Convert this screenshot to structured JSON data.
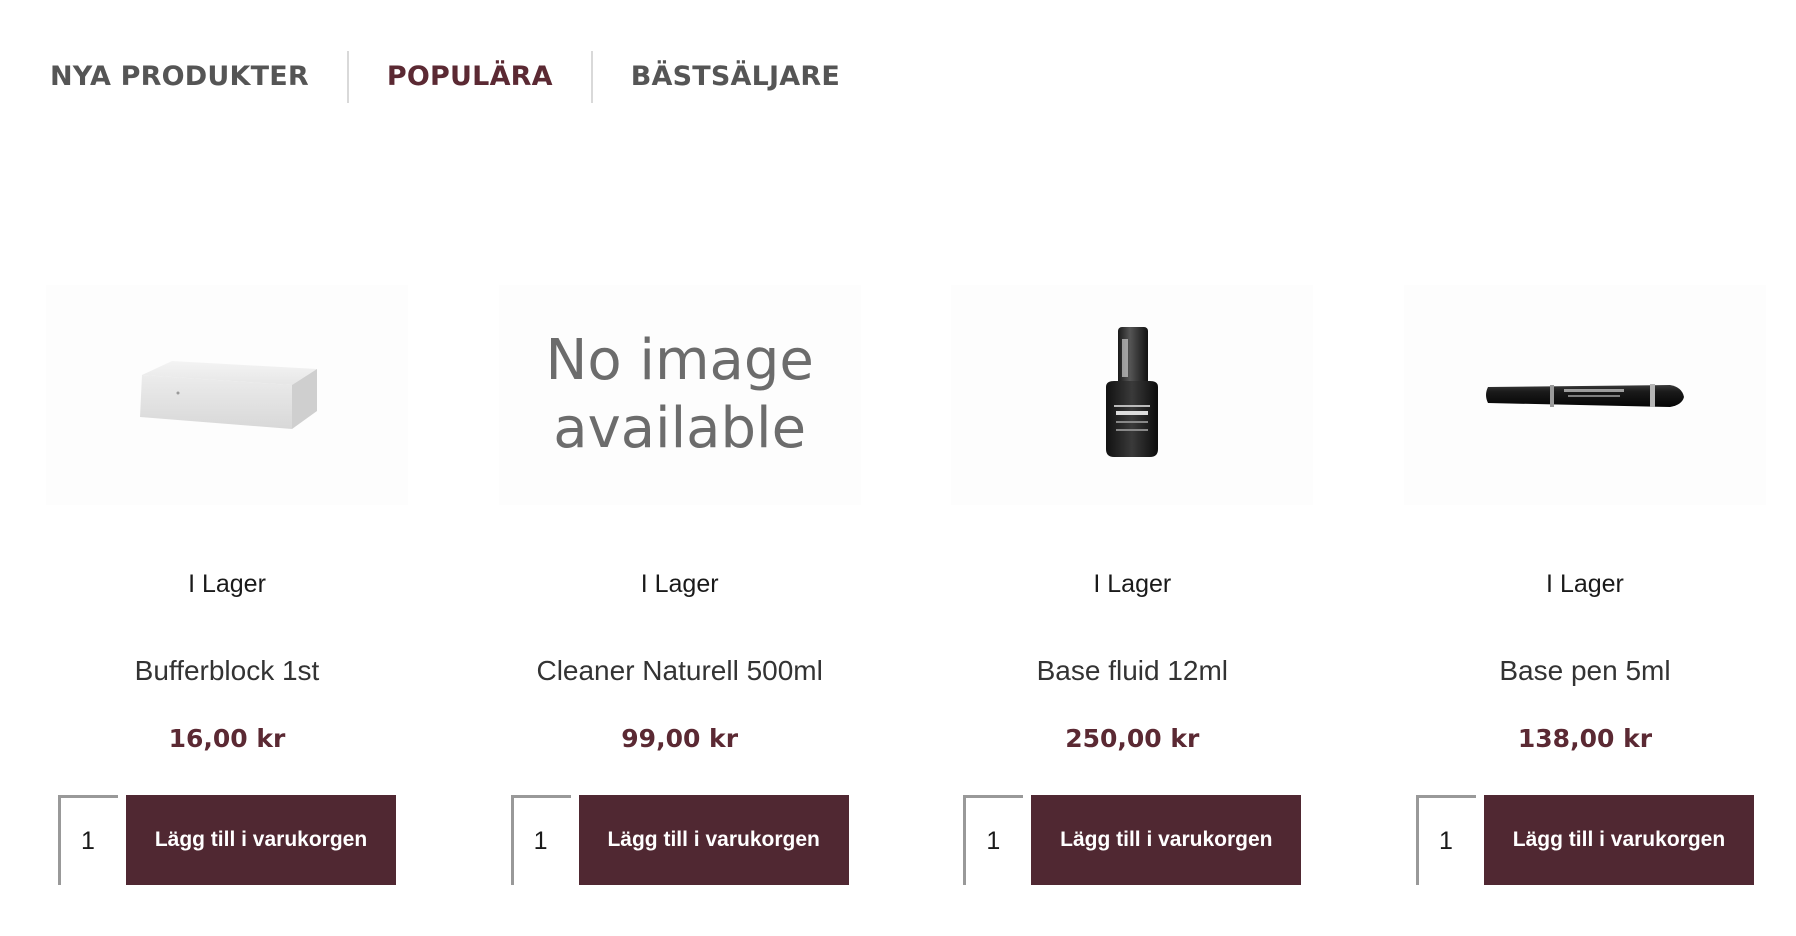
{
  "tabs": [
    {
      "label": "NYA PRODUKTER",
      "active": false
    },
    {
      "label": "POPULÄRA",
      "active": true
    },
    {
      "label": "BÄSTSÄLJARE",
      "active": false
    }
  ],
  "colors": {
    "brand": "#502832",
    "active_tab": "#5b2933",
    "price": "#5b2933"
  },
  "products": [
    {
      "image": "buffer-block-image",
      "stock": "I Lager",
      "name": "Bufferblock 1st",
      "price": "16,00 kr",
      "quantity": "1",
      "add_label": "Lägg till i varukorgen"
    },
    {
      "image": "no-image-placeholder",
      "no_image_line1": "No image",
      "no_image_line2": "available",
      "stock": "I Lager",
      "name": "Cleaner Naturell 500ml",
      "price": "99,00 kr",
      "quantity": "1",
      "add_label": "Lägg till i varukorgen"
    },
    {
      "image": "base-fluid-bottle-image",
      "stock": "I Lager",
      "name": "Base fluid 12ml",
      "price": "250,00 kr",
      "quantity": "1",
      "add_label": "Lägg till i varukorgen"
    },
    {
      "image": "base-pen-image",
      "stock": "I Lager",
      "name": "Base pen 5ml",
      "price": "138,00 kr",
      "quantity": "1",
      "add_label": "Lägg till i varukorgen"
    }
  ]
}
